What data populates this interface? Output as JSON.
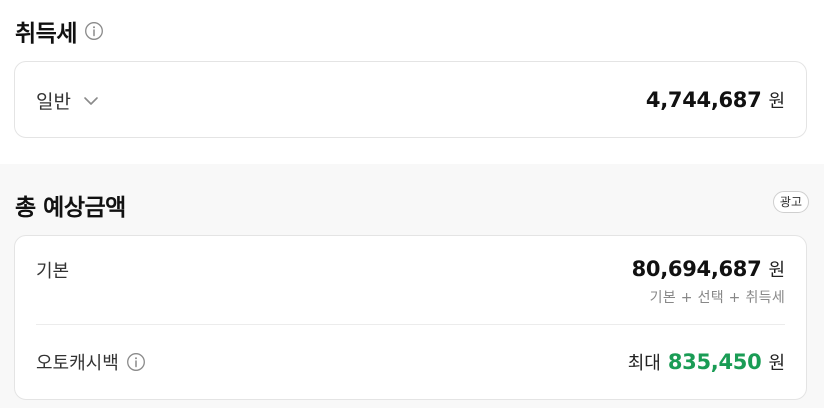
{
  "tax_section": {
    "title": "취득세",
    "info_icon": "info-circle-icon",
    "card": {
      "dropdown_label": "일반",
      "dropdown_icon": "chevron-down-icon",
      "amount": "4,744,687",
      "unit": "원"
    }
  },
  "estimate_section": {
    "title": "총 예상금액",
    "ad_badge": "광고",
    "base": {
      "label": "기본",
      "amount": "80,694,687",
      "unit": "원",
      "note": "기본 + 선택 + 취득세"
    },
    "cashback": {
      "label": "오토캐시백",
      "info_icon": "info-circle-icon",
      "prefix": "최대",
      "amount": "835,450",
      "unit": "원",
      "amount_color": "#1a9c55"
    }
  },
  "colors": {
    "background_bottom": "#f8f8f8",
    "card_border": "#e4e4e4",
    "accent_green": "#1a9c55"
  }
}
